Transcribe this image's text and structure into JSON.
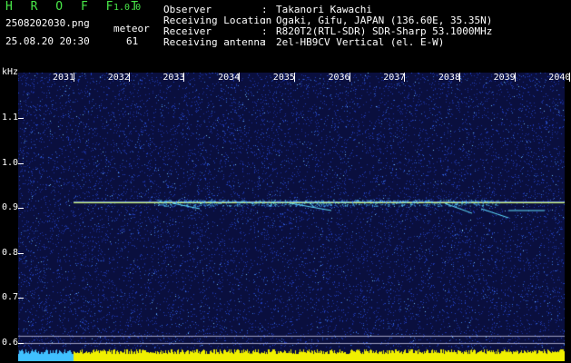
{
  "header": {
    "brand": "H R O F F T",
    "version": "1.0.0",
    "filename": "2508202030.png",
    "meteor_label": "meteor",
    "datetime": "25.08.20 20:30",
    "meteor_count": "61"
  },
  "info": [
    {
      "key": "Observer",
      "sep": ":",
      "value": "Takanori Kawachi"
    },
    {
      "key": "Receiving Location",
      "sep": ":",
      "value": "Ogaki, Gifu, JAPAN (136.60E, 35.35N)"
    },
    {
      "key": "Receiver",
      "sep": ":",
      "value": "R820T2(RTL-SDR) SDR-Sharp 53.1000MHz"
    },
    {
      "key": "Receiving antenna",
      "sep": ":",
      "value": "2el-HB9CV Vertical (el. E-W)"
    }
  ],
  "spectrogram": {
    "y_unit": "kHz",
    "y_ticks": [
      "1.1",
      "1.0",
      "0.9",
      "0.8",
      "0.7",
      "0.6"
    ],
    "x_ticks": [
      "2031",
      "2032",
      "2033",
      "2034",
      "2035",
      "2036",
      "2037",
      "2038",
      "2039",
      "2040"
    ],
    "colors": {
      "background": "#0a0f3e",
      "noise": "#2244c8",
      "carrier": "#c8f060",
      "echo": "#60e0ff",
      "level_bar": "#f0f000",
      "level_bar_left": "#40c0ff"
    }
  }
}
